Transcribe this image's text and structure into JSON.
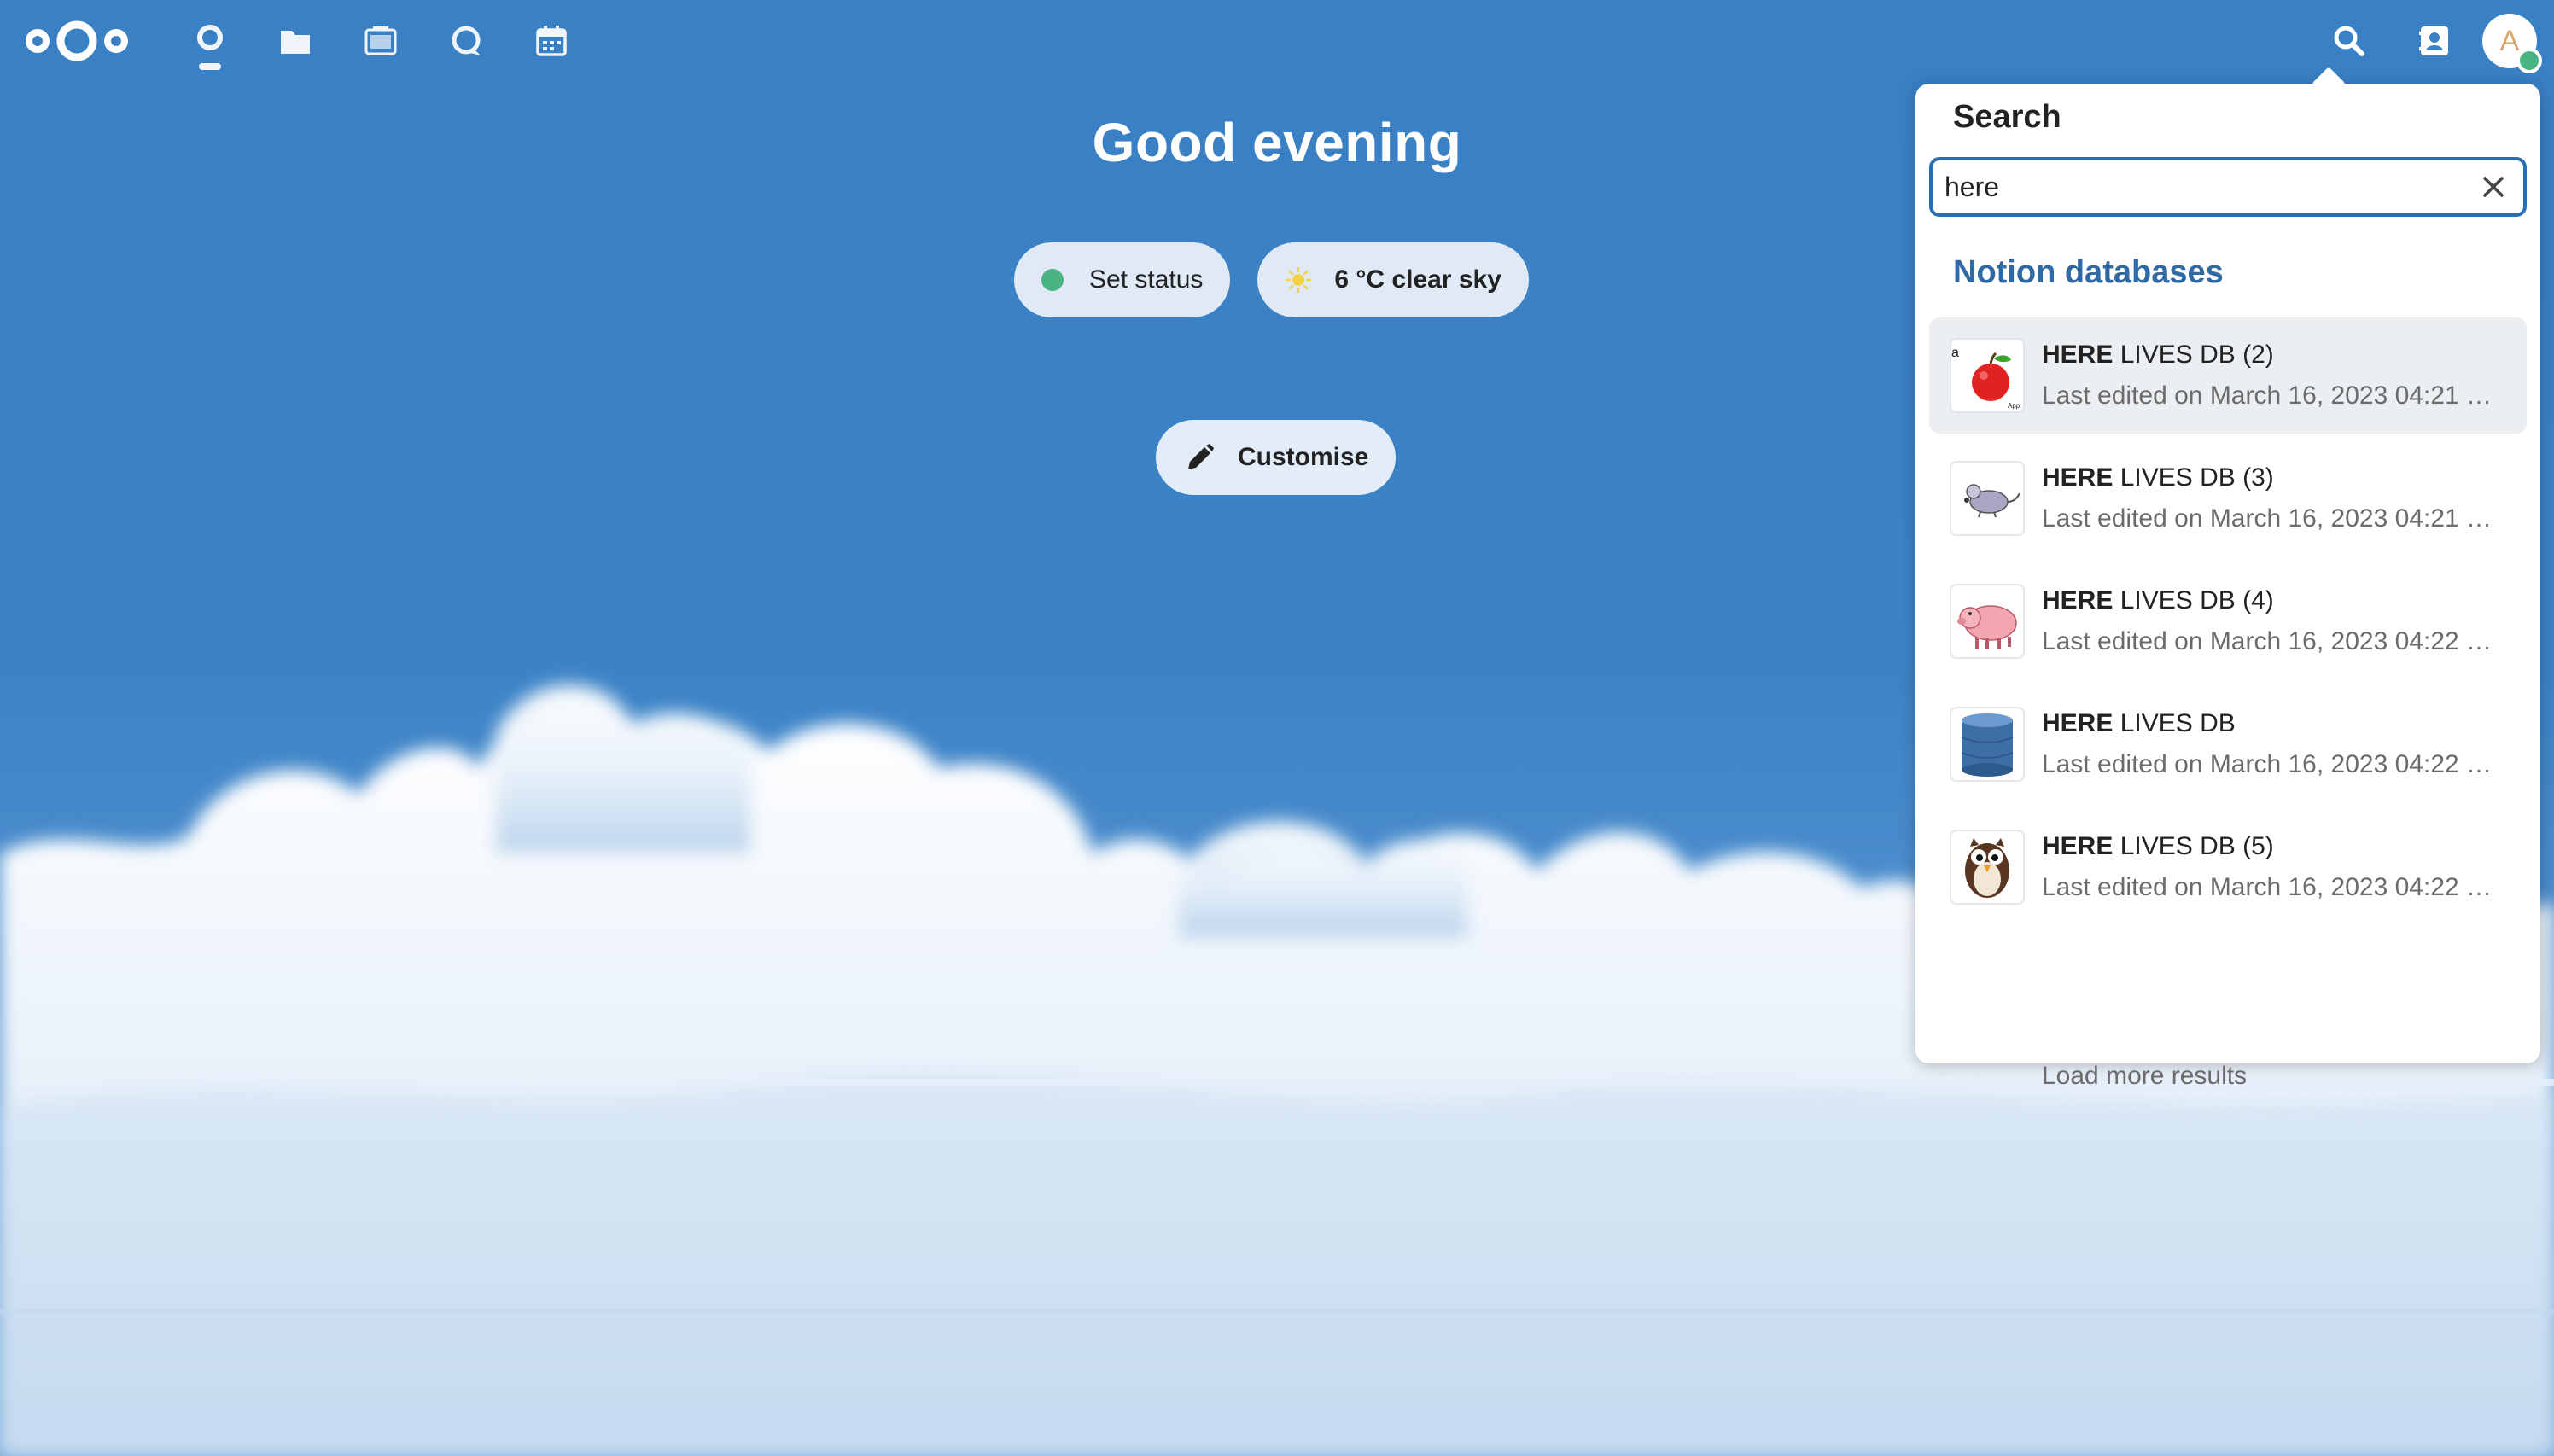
{
  "header": {
    "apps": [
      {
        "name": "dashboard-icon"
      },
      {
        "name": "files-icon"
      },
      {
        "name": "photos-icon"
      },
      {
        "name": "talk-icon"
      },
      {
        "name": "calendar-icon"
      }
    ],
    "avatar_initial": "A",
    "status_color": "#49b382"
  },
  "dashboard": {
    "greeting": "Good evening",
    "set_status": "Set status",
    "weather": "6 °C clear sky",
    "customise": "Customise"
  },
  "search": {
    "title": "Search",
    "query": "here",
    "section": "Notion databases",
    "results": [
      {
        "highlight": "HERE",
        "rest": " LIVES DB (2)",
        "subtitle": "Last edited on March 16, 2023 04:21 …",
        "thumb": "apple-icon"
      },
      {
        "highlight": "HERE",
        "rest": " LIVES DB (3)",
        "subtitle": "Last edited on March 16, 2023 04:21 …",
        "thumb": "mouse-icon"
      },
      {
        "highlight": "HERE",
        "rest": " LIVES DB (4)",
        "subtitle": "Last edited on March 16, 2023 04:22 …",
        "thumb": "pig-icon"
      },
      {
        "highlight": "HERE",
        "rest": " LIVES DB",
        "subtitle": "Last edited on March 16, 2023 04:22 …",
        "thumb": "database-icon"
      },
      {
        "highlight": "HERE",
        "rest": " LIVES DB (5)",
        "subtitle": "Last edited on March 16, 2023 04:22 …",
        "thumb": "owl-icon"
      }
    ],
    "load_more": "Load more results"
  },
  "colors": {
    "sky": "#3a80c5",
    "accent": "#2f6aa6",
    "online": "#49b382"
  }
}
